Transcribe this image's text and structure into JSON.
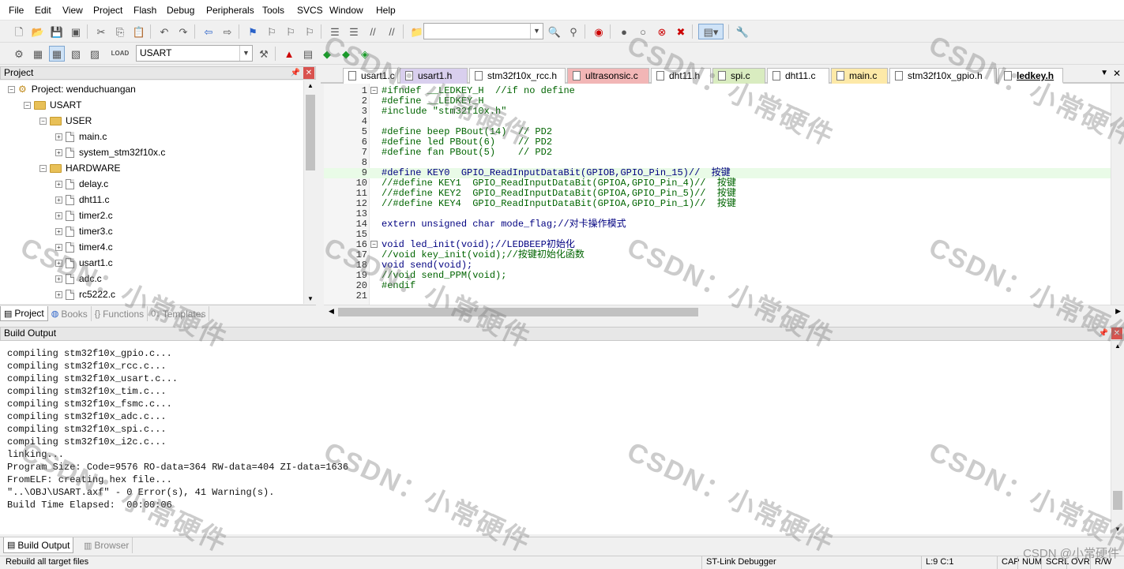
{
  "menu": [
    "File",
    "Edit",
    "View",
    "Project",
    "Flash",
    "Debug",
    "Peripherals",
    "Tools",
    "SVCS",
    "Window",
    "Help"
  ],
  "toolbar": {
    "target_select": "USART"
  },
  "project_panel": {
    "title": "Project",
    "tree": [
      {
        "label": "Project: wenduchuangan",
        "type": "project",
        "level": 0
      },
      {
        "label": "USART",
        "type": "folder",
        "level": 1
      },
      {
        "label": "USER",
        "type": "folder",
        "level": 2
      },
      {
        "label": "main.c",
        "type": "file",
        "level": 3
      },
      {
        "label": "system_stm32f10x.c",
        "type": "file",
        "level": 3
      },
      {
        "label": "HARDWARE",
        "type": "folder",
        "level": 2
      },
      {
        "label": "delay.c",
        "type": "file",
        "level": 3
      },
      {
        "label": "dht11.c",
        "type": "file",
        "level": 3
      },
      {
        "label": "timer2.c",
        "type": "file",
        "level": 3
      },
      {
        "label": "timer3.c",
        "type": "file",
        "level": 3
      },
      {
        "label": "timer4.c",
        "type": "file",
        "level": 3
      },
      {
        "label": "usart1.c",
        "type": "file",
        "level": 3
      },
      {
        "label": "adc.c",
        "type": "file",
        "level": 3
      },
      {
        "label": "rc5222.c",
        "type": "file",
        "level": 3
      }
    ],
    "tabs": [
      "Project",
      "Books",
      "Functions",
      "Templates"
    ]
  },
  "editor": {
    "tabs": [
      {
        "label": "usart1.c",
        "color": "#fff"
      },
      {
        "label": "usart1.h",
        "color": "#d9cfee"
      },
      {
        "label": "stm32f10x_rcc.h",
        "color": "#fff"
      },
      {
        "label": "ultrasonsic.c",
        "color": "#f2b6b6"
      },
      {
        "label": "dht11.h",
        "color": "#fff"
      },
      {
        "label": "spi.c",
        "color": "#d9ecc0"
      },
      {
        "label": "dht11.c",
        "color": "#fff"
      },
      {
        "label": "main.c",
        "color": "#fde9a8"
      },
      {
        "label": "stm32f10x_gpio.h",
        "color": "#fff"
      },
      {
        "label": "ledkey.h",
        "color": "#fff"
      }
    ],
    "lines": [
      "#ifndef __LEDKEY_H  //if no define",
      "#define __LEDKEY_H",
      "#include \"stm32f10x.h\"",
      "",
      "#define beep PBout(14)  // PD2",
      "#define led PBout(6)    // PD2",
      "#define fan PBout(5)    // PD2",
      "",
      "#define KEY0  GPIO_ReadInputDataBit(GPIOB,GPIO_Pin_15)//  按键",
      "//#define KEY1  GPIO_ReadInputDataBit(GPIOA,GPIO_Pin_4)//  按键",
      "//#define KEY2  GPIO_ReadInputDataBit(GPIOA,GPIO_Pin_5)//  按键",
      "//#define KEY4  GPIO_ReadInputDataBit(GPIOA,GPIO_Pin_1)//  按键",
      "",
      "extern unsigned char mode_flag;//对卡操作模式",
      "",
      "void led_init(void);//LEDBEEP初始化",
      "//void key_init(void);//按键初始化函数",
      "void send(void);",
      "//void send_PPM(void);",
      "#endif",
      ""
    ]
  },
  "build_output": {
    "title": "Build Output",
    "lines": [
      "compiling stm32f10x_gpio.c...",
      "compiling stm32f10x_rcc.c...",
      "compiling stm32f10x_usart.c...",
      "compiling stm32f10x_tim.c...",
      "compiling stm32f10x_fsmc.c...",
      "compiling stm32f10x_adc.c...",
      "compiling stm32f10x_spi.c...",
      "compiling stm32f10x_i2c.c...",
      "linking...",
      "Program Size: Code=9576 RO-data=364 RW-data=404 ZI-data=1636",
      "FromELF: creating hex file...",
      "\"..\\OBJ\\USART.axf\" - 0 Error(s), 41 Warning(s).",
      "Build Time Elapsed:  00:00:06"
    ],
    "tabs": [
      "Build Output",
      "Browser"
    ]
  },
  "status": {
    "message": "Rebuild all target files",
    "debugger": "ST-Link Debugger",
    "position": "L:9 C:1",
    "indicators": [
      "CAP",
      "NUM",
      "SCRL",
      "OVR",
      "R/W"
    ]
  },
  "watermark": {
    "text": "CSDN：小常硬件",
    "signature": "CSDN @小常硬件"
  }
}
